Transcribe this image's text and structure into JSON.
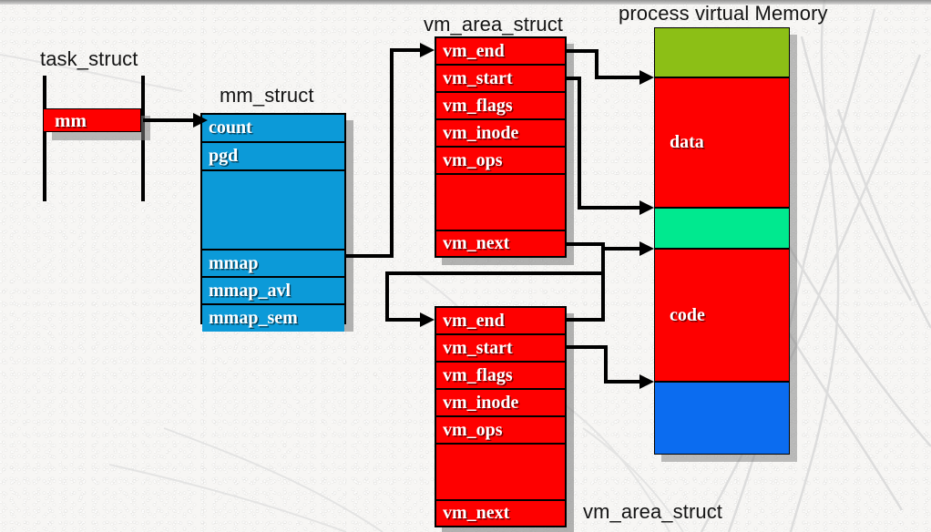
{
  "diagram": {
    "title_labels": {
      "task_struct": "task_struct",
      "mm_struct": "mm_struct",
      "vm_area_struct_top": "vm_area_struct",
      "vm_area_struct_bottom": "vm_area_struct",
      "process_virtual_memory": "process virtual Memory"
    },
    "task_struct": {
      "field": "mm",
      "field_color": "#fe0000"
    },
    "mm_struct": {
      "color": "#0c9ad8",
      "rows": [
        {
          "label": "count",
          "height": 31
        },
        {
          "label": "pgd",
          "height": 31
        },
        {
          "label": "",
          "height": 87
        },
        {
          "label": "mmap",
          "height": 30
        },
        {
          "label": "mmap_avl",
          "height": 30
        },
        {
          "label": "mmap_sem",
          "height": 30
        }
      ]
    },
    "vm_area_struct_top": {
      "color": "#fe0000",
      "rows": [
        {
          "label": "vm_end",
          "height": 30
        },
        {
          "label": "vm_start",
          "height": 30
        },
        {
          "label": "vm_flags",
          "height": 30
        },
        {
          "label": "vm_inode",
          "height": 30
        },
        {
          "label": "vm_ops",
          "height": 30
        },
        {
          "label": "",
          "height": 62
        },
        {
          "label": "vm_next",
          "height": 31
        }
      ]
    },
    "vm_area_struct_bottom": {
      "color": "#fe0000",
      "rows": [
        {
          "label": "vm_end",
          "height": 30
        },
        {
          "label": "vm_start",
          "height": 30
        },
        {
          "label": "vm_flags",
          "height": 30
        },
        {
          "label": "vm_inode",
          "height": 30
        },
        {
          "label": "vm_ops",
          "height": 30
        },
        {
          "label": "",
          "height": 62
        },
        {
          "label": "vm_next",
          "height": 31
        }
      ]
    },
    "process_virtual_memory": {
      "blocks": [
        {
          "label": "",
          "color": "#8cbf16",
          "height": 55
        },
        {
          "label": "data",
          "color": "#fe0000",
          "height": 143
        },
        {
          "label": "",
          "color": "#00e98f",
          "height": 45
        },
        {
          "label": "code",
          "color": "#fe0000",
          "height": 146
        },
        {
          "label": "",
          "color": "#0b6cf0",
          "height": 80
        }
      ]
    },
    "connectors": [
      {
        "name": "task-mm-to-mm-struct",
        "from": "task_struct.mm",
        "to": "mm_struct.count"
      },
      {
        "name": "mmap-to-vma-top",
        "from": "mm_struct.mmap",
        "to": "vm_area_struct_top.vm_end"
      },
      {
        "name": "vma-top-vm-end-to-memory",
        "from": "vm_area_struct_top.vm_end",
        "to": "process_virtual_memory.data_top"
      },
      {
        "name": "vma-top-vm-start-to-memory",
        "from": "vm_area_struct_top.vm_start",
        "to": "process_virtual_memory.data_bottom"
      },
      {
        "name": "vma-top-vm-next-to-vma-bottom",
        "from": "vm_area_struct_top.vm_next",
        "to": "vm_area_struct_bottom.vm_end"
      },
      {
        "name": "vma-bottom-vm-end-to-memory",
        "from": "vm_area_struct_bottom.vm_end",
        "to": "process_virtual_memory.code_top"
      },
      {
        "name": "vma-bottom-vm-start-to-memory",
        "from": "vm_area_struct_bottom.vm_start",
        "to": "process_virtual_memory.code_bottom"
      }
    ]
  }
}
